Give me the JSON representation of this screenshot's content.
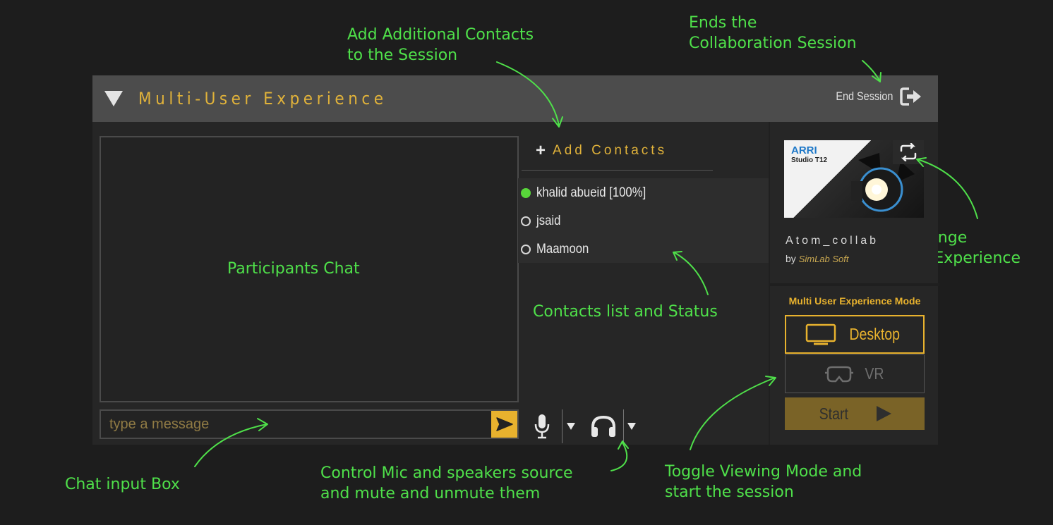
{
  "annotations": {
    "add_contacts": "Add Additional Contacts\nto the Session",
    "end_session": "Ends the\nCollaboration Session",
    "participants_chat": "Participants Chat",
    "contacts_list": "Contacts list and Status",
    "change_vr": "Change\nVR Experience",
    "chat_input": "Chat input Box",
    "mic_speakers": "Control Mic and speakers source\nand mute and unmute them",
    "toggle_mode": "Toggle Viewing Mode and\nstart the session"
  },
  "header": {
    "title": "Multi-User Experience",
    "end_session": "End Session"
  },
  "chat": {
    "placeholder": "type a message"
  },
  "contacts": {
    "add_label": "Add Contacts",
    "list": [
      {
        "name": "khalid abueid [100%]",
        "online": true
      },
      {
        "name": "jsaid",
        "online": false
      },
      {
        "name": "Maamoon",
        "online": false
      }
    ]
  },
  "experience": {
    "thumb_brand": "ARRI",
    "thumb_model": "Studio T12",
    "name": "Atom_collab",
    "by": "by",
    "author": "SimLab Soft"
  },
  "mode": {
    "title": "Multi User Experience Mode",
    "desktop": "Desktop",
    "vr": "VR",
    "start": "Start",
    "selected": "desktop"
  },
  "colors": {
    "accent": "#e8b22e",
    "annotation": "#4fe04a",
    "online": "#58d63a"
  }
}
